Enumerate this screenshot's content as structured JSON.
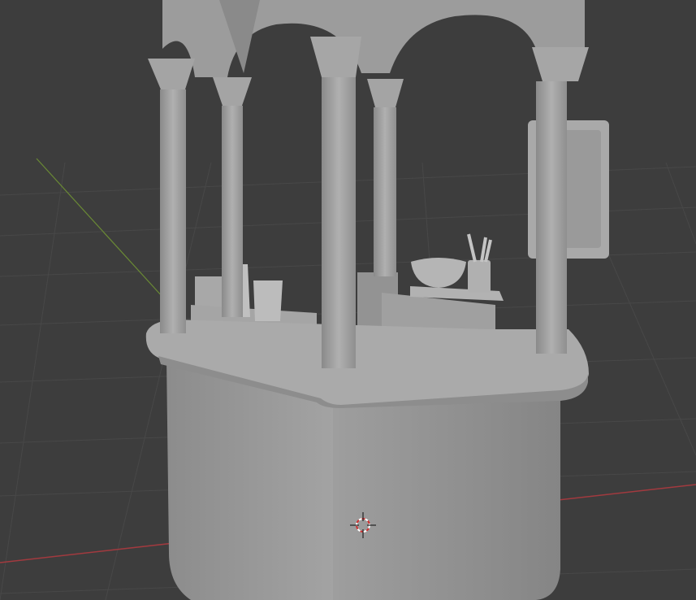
{
  "viewport": {
    "shading": "solid",
    "colors": {
      "background": "#3d3d3d",
      "grid": "#4a4a4a",
      "x_axis": "#a23a3f",
      "y_axis": "#6a8a35",
      "model": "#9a9a9a"
    },
    "icons": [
      "3d-cursor-icon"
    ]
  }
}
